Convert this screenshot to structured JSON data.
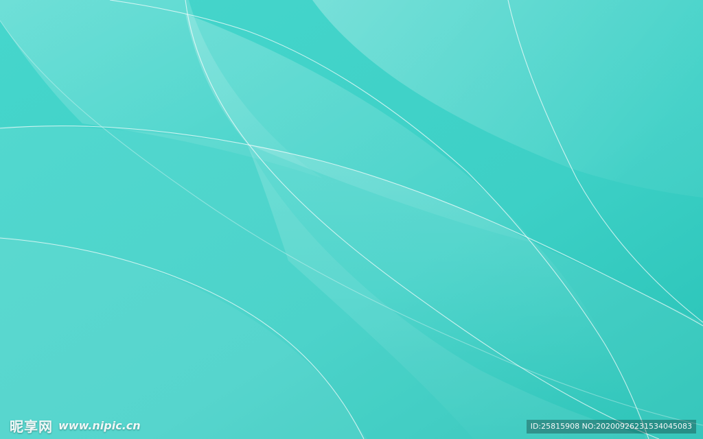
{
  "watermark": {
    "site_name_cn": "昵享网",
    "site_url": "www.nipic.cn",
    "image_id": "ID:25815908 NO:20200926231534045083"
  },
  "colors": {
    "base": "#3fd2c8",
    "light": "#7fe6dc",
    "dark": "#2fc4b9"
  }
}
